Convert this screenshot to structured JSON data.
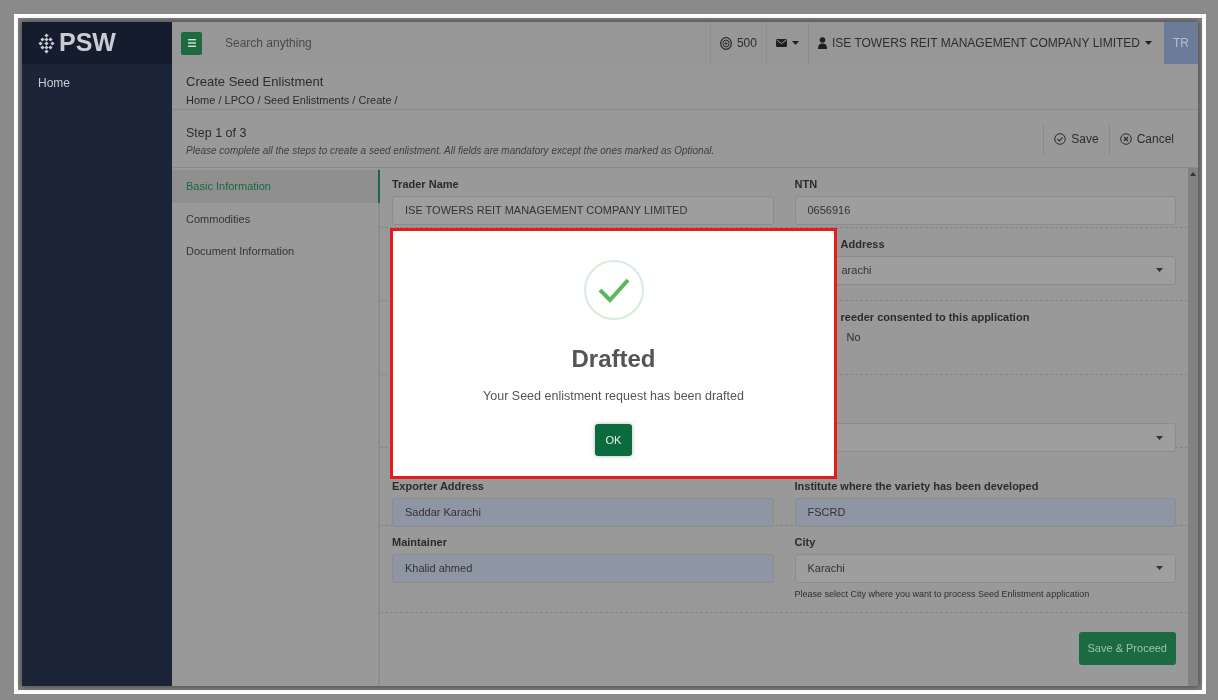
{
  "topbar": {
    "logo": "PSW",
    "search": {
      "placeholder": "Search anything"
    },
    "coins": "500",
    "user": "ISE TOWERS REIT MANAGEMENT COMPANY LIMITED",
    "avatar": "TR"
  },
  "sidebar": {
    "items": [
      {
        "label": "Home"
      }
    ]
  },
  "page": {
    "title": "Create Seed Enlistment",
    "breadcrumb": [
      "Home",
      "LPCO",
      "Seed Enlistments",
      "Create"
    ],
    "separator": "/"
  },
  "step": {
    "title": "Step 1 of 3",
    "description": "Please complete all the steps to create a seed enlistment. All fields are mandatory except the ones marked as Optional.",
    "actions": [
      {
        "kind": "save",
        "label": "Save"
      },
      {
        "kind": "cancel",
        "label": "Cancel"
      }
    ]
  },
  "steps": [
    {
      "label": "Basic Information",
      "selected": true
    },
    {
      "label": "Commodities",
      "selected": false
    },
    {
      "label": "Document Information",
      "selected": false
    }
  ],
  "form_rows": [
    {
      "left": {
        "kind": "text",
        "label": "Trader Name",
        "value": "ISE TOWERS REIT MANAGEMENT COMPANY LIMITED",
        "disabled": true
      },
      "right": {
        "kind": "text",
        "label": "NTN",
        "value": "0656916",
        "disabled": true
      }
    },
    {
      "right": {
        "kind": "select",
        "label": "Address",
        "value": "arachi"
      }
    },
    {
      "right": {
        "kind": "radio",
        "label": "reeder consented to this application",
        "options": [
          "No"
        ]
      }
    },
    {
      "right": {
        "kind": "select"
      }
    },
    {
      "left": {
        "kind": "text",
        "label": "Exporter Address",
        "value": "Saddar Karachi",
        "disabled": false
      },
      "right": {
        "kind": "text",
        "label": "Institute where the variety has been developed",
        "value": "FSCRD",
        "disabled": false
      }
    },
    {
      "left": {
        "kind": "text",
        "label": "Maintainer",
        "value": "Khalid ahmed",
        "disabled": false
      },
      "right": {
        "kind": "select",
        "label": "City",
        "value": "Karachi",
        "help": "Please select City where you want to process Seed Enlistment application"
      }
    }
  ],
  "footer": {
    "button": "Save & Proceed"
  },
  "dialog": {
    "title": "Drafted",
    "message": "Your Seed enlistment request has been drafted",
    "button": "OK"
  }
}
